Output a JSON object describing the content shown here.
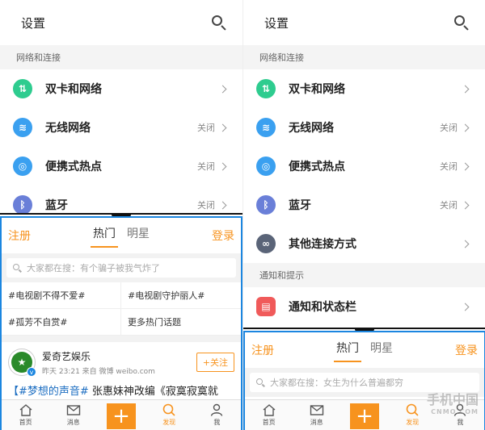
{
  "colors": {
    "accent_orange": "#f7931e",
    "frame_blue": "#1b86e0",
    "icon_green": "#2ecc8f",
    "icon_blue": "#3aa0f0",
    "icon_purple": "#6a7fd8",
    "icon_gray": "#5a6478",
    "icon_red": "#f05a5a"
  },
  "left": {
    "settings": {
      "title": "设置",
      "section": "网络和连接",
      "rows": [
        {
          "icon": "dual-sim-icon",
          "glyph": "⇅",
          "label": "双卡和网络",
          "value": ""
        },
        {
          "icon": "wifi-icon",
          "glyph": "≋",
          "label": "无线网络",
          "value": "关闭"
        },
        {
          "icon": "hotspot-icon",
          "glyph": "◎",
          "label": "便携式热点",
          "value": "关闭"
        },
        {
          "icon": "bluetooth-icon",
          "glyph": "ᛒ",
          "label": "蓝牙",
          "value": "关闭"
        }
      ]
    },
    "weibo": {
      "register": "注册",
      "login": "登录",
      "tabs": [
        "热门",
        "明星"
      ],
      "search_placeholder": "大家都在搜：有个骗子被我气炸了",
      "topics": [
        "#电视剧不得不爱#",
        "#电视剧守护丽人#",
        "#孤芳不自赏#",
        "更多热门话题"
      ],
      "post": {
        "author": "爱奇艺娱乐",
        "time": "昨天 23:21  来自 微博 weibo.com",
        "follow": "+关注",
        "hashtag": "【#梦想的声音#",
        "text": " 张惠妹神改编《寂寞寂寞就"
      }
    },
    "tabbar": {
      "items": [
        {
          "icon": "home-icon",
          "label": "首页"
        },
        {
          "icon": "message-icon",
          "label": "消息"
        },
        {
          "icon": "plus-icon",
          "label": ""
        },
        {
          "icon": "discover-icon",
          "label": "发现"
        },
        {
          "icon": "profile-icon",
          "label": "我"
        }
      ]
    }
  },
  "right": {
    "settings": {
      "title": "设置",
      "section": "网络和连接",
      "section2": "通知和提示",
      "rows": [
        {
          "icon": "dual-sim-icon",
          "glyph": "⇅",
          "label": "双卡和网络",
          "value": ""
        },
        {
          "icon": "wifi-icon",
          "glyph": "≋",
          "label": "无线网络",
          "value": "关闭"
        },
        {
          "icon": "hotspot-icon",
          "glyph": "◎",
          "label": "便携式热点",
          "value": "关闭"
        },
        {
          "icon": "bluetooth-icon",
          "glyph": "ᛒ",
          "label": "蓝牙",
          "value": "关闭"
        },
        {
          "icon": "link-icon",
          "glyph": "∞",
          "label": "其他连接方式",
          "value": ""
        }
      ],
      "notification_row": {
        "icon": "notification-icon",
        "glyph": "▤",
        "label": "通知和状态栏",
        "value": ""
      }
    },
    "weibo": {
      "register": "注册",
      "login": "登录",
      "tabs": [
        "热门",
        "明星"
      ],
      "search_placeholder": "大家都在搜：女生为什么普遍都穷"
    },
    "tabbar": {
      "items": [
        {
          "icon": "home-icon",
          "label": "首页"
        },
        {
          "icon": "message-icon",
          "label": "消息"
        },
        {
          "icon": "plus-icon",
          "label": ""
        },
        {
          "icon": "discover-icon",
          "label": "发现"
        },
        {
          "icon": "profile-icon",
          "label": "我"
        }
      ]
    }
  },
  "watermark": {
    "main": "手机中国",
    "sub": "CNMO.COM"
  }
}
